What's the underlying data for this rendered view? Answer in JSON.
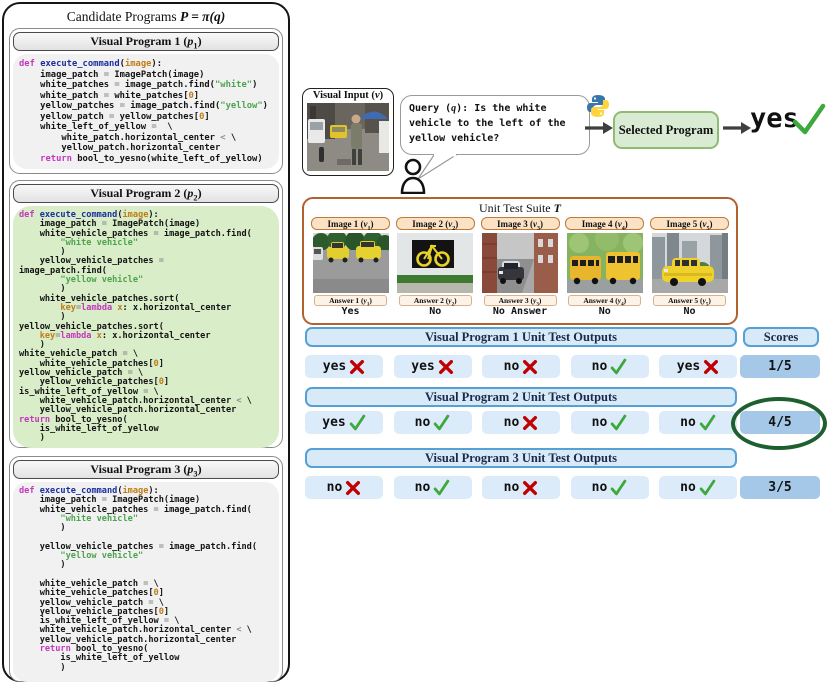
{
  "panel": {
    "title_pre": "Candidate Programs ",
    "title_math": "P = π(q)"
  },
  "programs": [
    {
      "header_pre": "Visual Program 1 (",
      "header_var": "p",
      "header_sub": "1",
      "header_post": ")",
      "code": [
        [
          [
            "k",
            "def "
          ],
          [
            "f",
            "execute_command"
          ],
          [
            "p",
            "("
          ],
          [
            "a",
            "image"
          ],
          [
            "p",
            "):"
          ]
        ],
        [
          [
            "p",
            "    image_patch "
          ],
          [
            "o",
            "="
          ],
          [
            "p",
            " ImagePatch(image)"
          ]
        ],
        [
          [
            "p",
            "    white_patches "
          ],
          [
            "o",
            "="
          ],
          [
            "p",
            " image_patch.find("
          ],
          [
            "s",
            "\"white\""
          ],
          [
            "p",
            ")"
          ]
        ],
        [
          [
            "p",
            "    white_patch "
          ],
          [
            "o",
            "="
          ],
          [
            "p",
            " white_patches["
          ],
          [
            "n",
            "0"
          ],
          [
            "p",
            "]"
          ]
        ],
        [
          [
            "p",
            "    yellow_patches "
          ],
          [
            "o",
            "="
          ],
          [
            "p",
            " image_patch.find("
          ],
          [
            "s",
            "\"yellow\""
          ],
          [
            "p",
            ")"
          ]
        ],
        [
          [
            "p",
            "    yellow_patch "
          ],
          [
            "o",
            "="
          ],
          [
            "p",
            " yellow_patches["
          ],
          [
            "n",
            "0"
          ],
          [
            "p",
            "]"
          ]
        ],
        [
          [
            "p",
            "    white_left_of_yellow "
          ],
          [
            "o",
            "="
          ],
          [
            "p",
            "  \\"
          ]
        ],
        [
          [
            "p",
            "        white_patch.horizontal_center "
          ],
          [
            "o",
            "<"
          ],
          [
            "p",
            " \\"
          ]
        ],
        [
          [
            "p",
            "        yellow_patch.horizontal_center"
          ]
        ],
        [
          [
            "k",
            "    return"
          ],
          [
            "p",
            " bool_to_yesno(white_left_of_yellow)"
          ]
        ]
      ]
    },
    {
      "header_pre": "Visual Program 2 (",
      "header_var": "p",
      "header_sub": "2",
      "header_post": ")",
      "code": [
        [
          [
            "k",
            "def "
          ],
          [
            "f",
            "execute_command"
          ],
          [
            "p",
            "("
          ],
          [
            "a",
            "image"
          ],
          [
            "p",
            "):"
          ]
        ],
        [
          [
            "p",
            "    image_patch "
          ],
          [
            "o",
            "="
          ],
          [
            "p",
            " ImagePatch(image)"
          ]
        ],
        [
          [
            "p",
            "    white_vehicle_patches "
          ],
          [
            "o",
            "="
          ],
          [
            "p",
            " image_patch.find("
          ]
        ],
        [
          [
            "s",
            "        \"white vehicle\""
          ]
        ],
        [
          [
            "p",
            "        )"
          ]
        ],
        [
          [
            "p",
            "    yellow_vehicle_patches "
          ],
          [
            "o",
            "="
          ]
        ],
        [
          [
            "p",
            "image_patch.find("
          ]
        ],
        [
          [
            "s",
            "        \"yellow vehicle\""
          ]
        ],
        [
          [
            "p",
            "        )"
          ]
        ],
        [
          [
            "p",
            "    white_vehicle_patches.sort("
          ]
        ],
        [
          [
            "p",
            "        "
          ],
          [
            "a",
            "key"
          ],
          [
            "o",
            "="
          ],
          [
            "k",
            "lambda"
          ],
          [
            "p",
            " "
          ],
          [
            "a",
            "x"
          ],
          [
            "p",
            ": x.horizontal_center"
          ]
        ],
        [
          [
            "p",
            "        )"
          ]
        ],
        [
          [
            "p",
            "yellow_vehicle_patches.sort("
          ]
        ],
        [
          [
            "p",
            "    "
          ],
          [
            "a",
            "key"
          ],
          [
            "o",
            "="
          ],
          [
            "k",
            "lambda"
          ],
          [
            "p",
            " "
          ],
          [
            "a",
            "x"
          ],
          [
            "p",
            ": x.horizontal_center"
          ]
        ],
        [
          [
            "p",
            "    )"
          ]
        ],
        [
          [
            "p",
            "white_vehicle_patch "
          ],
          [
            "o",
            "="
          ],
          [
            "p",
            " \\"
          ]
        ],
        [
          [
            "p",
            "    white_vehicle_patches["
          ],
          [
            "n",
            "0"
          ],
          [
            "p",
            "]"
          ]
        ],
        [
          [
            "p",
            "yellow_vehicle_patch "
          ],
          [
            "o",
            "="
          ],
          [
            "p",
            " \\"
          ]
        ],
        [
          [
            "p",
            "    yellow_vehicle_patches["
          ],
          [
            "n",
            "0"
          ],
          [
            "p",
            "]"
          ]
        ],
        [
          [
            "p",
            "is_white_left_of_yellow "
          ],
          [
            "o",
            "="
          ],
          [
            "p",
            " \\"
          ]
        ],
        [
          [
            "p",
            "    white_vehicle_patch.horizontal_center "
          ],
          [
            "o",
            "<"
          ],
          [
            "p",
            " \\"
          ]
        ],
        [
          [
            "p",
            "    yellow_vehicle_patch.horizontal_center"
          ]
        ],
        [
          [
            "k",
            "return"
          ],
          [
            "p",
            " bool_to_yesno("
          ]
        ],
        [
          [
            "p",
            "    is_white_left_of_yellow"
          ]
        ],
        [
          [
            "p",
            "    )"
          ]
        ]
      ]
    },
    {
      "header_pre": "Visual Program 3 (",
      "header_var": "p",
      "header_sub": "3",
      "header_post": ")",
      "code": [
        [
          [
            "k",
            "def "
          ],
          [
            "f",
            "execute_command"
          ],
          [
            "p",
            "("
          ],
          [
            "a",
            "image"
          ],
          [
            "p",
            "):"
          ]
        ],
        [
          [
            "p",
            "    image_patch "
          ],
          [
            "o",
            "="
          ],
          [
            "p",
            " ImagePatch(image)"
          ]
        ],
        [
          [
            "p",
            "    white_vehicle_patches "
          ],
          [
            "o",
            "="
          ],
          [
            "p",
            " image_patch.find("
          ]
        ],
        [
          [
            "s",
            "        \"white vehicle\""
          ]
        ],
        [
          [
            "p",
            "        )"
          ]
        ],
        [],
        [
          [
            "p",
            "    yellow_vehicle_patches "
          ],
          [
            "o",
            "="
          ],
          [
            "p",
            " image_patch.find("
          ]
        ],
        [
          [
            "s",
            "        \"yellow vehicle\""
          ]
        ],
        [
          [
            "p",
            "        )"
          ]
        ],
        [],
        [
          [
            "p",
            "    white_vehicle_patch "
          ],
          [
            "o",
            "="
          ],
          [
            "p",
            " \\"
          ]
        ],
        [
          [
            "p",
            "    white_vehicle_patches["
          ],
          [
            "n",
            "0"
          ],
          [
            "p",
            "]"
          ]
        ],
        [
          [
            "p",
            "    yellow_vehicle_patch "
          ],
          [
            "o",
            "="
          ],
          [
            "p",
            " \\"
          ]
        ],
        [
          [
            "p",
            "    yellow_vehicle_patches["
          ],
          [
            "n",
            "0"
          ],
          [
            "p",
            "]"
          ]
        ],
        [
          [
            "p",
            "    is_white_left_of_yellow "
          ],
          [
            "o",
            "="
          ],
          [
            "p",
            " \\"
          ]
        ],
        [
          [
            "p",
            "    white_vehicle_patch.horizontal_center "
          ],
          [
            "o",
            "<"
          ],
          [
            "p",
            " \\"
          ]
        ],
        [
          [
            "p",
            "    yellow_vehicle_patch.horizontal_center"
          ]
        ],
        [
          [
            "k",
            "    return"
          ],
          [
            "p",
            " bool_to_yesno("
          ]
        ],
        [
          [
            "p",
            "        is_white_left_of_yellow"
          ]
        ],
        [
          [
            "p",
            "        )"
          ]
        ]
      ]
    }
  ],
  "io": {
    "visual_input_pre": "Visual Input (",
    "visual_input_var": "v",
    "visual_input_post": ")",
    "query_label": "Query",
    "query_var_pre": " (",
    "query_var": "q",
    "query_var_post": "): ",
    "query_text": "Is the white vehicle to the left of the yellow vehicle?",
    "selected_program_label": "Selected Program",
    "final_answer": "yes"
  },
  "suite": {
    "title_pre": "Unit Test Suite ",
    "title_var": "T",
    "tests": [
      {
        "label_pre": "Image 1 (",
        "var": "v",
        "sub": "1",
        "label_post": ")",
        "ans_pre": "Answer 1 (",
        "avar": "y",
        "asub": "1",
        "ans_post": ")",
        "answer": "Yes"
      },
      {
        "label_pre": "Image 2 (",
        "var": "v",
        "sub": "2",
        "label_post": ")",
        "ans_pre": "Answer 2 (",
        "avar": "y",
        "asub": "2",
        "ans_post": ")",
        "answer": "No"
      },
      {
        "label_pre": "Image 3 (",
        "var": "v",
        "sub": "3",
        "label_post": ")",
        "ans_pre": "Answer 3 (",
        "avar": "y",
        "asub": "3",
        "ans_post": ")",
        "answer": "No Answer"
      },
      {
        "label_pre": "Image 4 (",
        "var": "v",
        "sub": "4",
        "label_post": ")",
        "ans_pre": "Answer 4 (",
        "avar": "y",
        "asub": "4",
        "ans_post": ")",
        "answer": "No"
      },
      {
        "label_pre": "Image 5 (",
        "var": "v",
        "sub": "5",
        "label_post": ")",
        "ans_pre": "Answer 5 (",
        "avar": "y",
        "asub": "5",
        "ans_post": ")",
        "answer": "No"
      }
    ]
  },
  "outputs": {
    "scores_header": "Scores",
    "rows": [
      {
        "header": "Visual Program 1 Unit Test Outputs",
        "score": "1/5",
        "circled": false,
        "cells": [
          {
            "text": "yes",
            "correct": false
          },
          {
            "text": "yes",
            "correct": false
          },
          {
            "text": "no",
            "correct": false
          },
          {
            "text": "no",
            "correct": true
          },
          {
            "text": "yes",
            "correct": false
          }
        ]
      },
      {
        "header": "Visual Program 2 Unit Test Outputs",
        "score": "4/5",
        "circled": true,
        "cells": [
          {
            "text": "yes",
            "correct": true
          },
          {
            "text": "no",
            "correct": true
          },
          {
            "text": "no",
            "correct": false
          },
          {
            "text": "no",
            "correct": true
          },
          {
            "text": "no",
            "correct": true
          }
        ]
      },
      {
        "header": "Visual Program 3 Unit Test Outputs",
        "score": "3/5",
        "circled": false,
        "cells": [
          {
            "text": "no",
            "correct": false
          },
          {
            "text": "no",
            "correct": true
          },
          {
            "text": "no",
            "correct": false
          },
          {
            "text": "no",
            "correct": true
          },
          {
            "text": "no",
            "correct": true
          }
        ]
      }
    ]
  },
  "colors": {
    "kw_magenta": "#C437BE",
    "fn_blue": "#1C2F9C",
    "arg_orange": "#BE7D17",
    "str_green": "#4DA44D",
    "op_gray": "#8A8A8A",
    "code_text": "#141414",
    "code_bg": "#F1F1F2",
    "p2_bg": "#D9EDC9",
    "suite_border": "#B0622F",
    "img_label_bg": "#FBE2C4",
    "img_label_border": "#C07937",
    "ans_bg": "#FDF2E6",
    "ans_border": "#D9B28C",
    "out_header_bg": "#D8E9F8",
    "out_header_border": "#55A1D6",
    "out_cell_bg": "#DCEBF9",
    "score_bg": "#A5C8E8",
    "check_green": "#3DA93D",
    "cross_red": "#C00000",
    "circle_green": "#1D5F2E",
    "sel_bg": "#DAEBD3",
    "sel_border": "#8FBC72",
    "arrow": "#3F3F3F"
  }
}
